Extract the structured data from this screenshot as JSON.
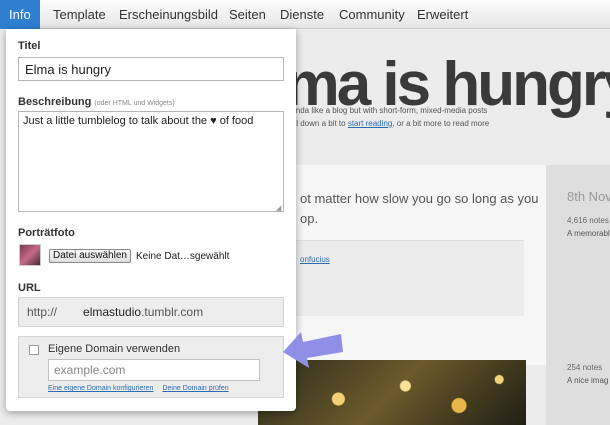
{
  "nav": {
    "tabs": [
      "Info",
      "Template",
      "Erscheinungsbild",
      "Seiten",
      "Dienste",
      "Community",
      "Erweitert"
    ],
    "active_index": 0
  },
  "colors": {
    "accent": "#2f7fd0",
    "arrow": "#8f8fe8"
  },
  "preview": {
    "title": "Elma is hungry",
    "tagline_1": "kinda like a blog but with short-form, mixed-media posts",
    "tagline_2_prefix": "oll down a bit to",
    "tagline_2_link": "start reading",
    "tagline_2_suffix": ", or a bit more to read more",
    "quote": "ot matter how slow you go so long as you op.",
    "quote_source": "onfucius",
    "side_date": "8th Nov",
    "side_notes_1": "4,616 notes",
    "side_link_1": "A memorabl",
    "side_notes_2": "254 notes",
    "side_link_2": "A nice imag"
  },
  "settings": {
    "title_label": "Titel",
    "title_value": "Elma is hungry",
    "description_label": "Beschreibung",
    "description_hint": "(oder HTML und Widgets)",
    "description_value": "Just a little tumblelog to talk about the ♥ of food",
    "portrait_label": "Porträtfoto",
    "file_button": "Datei auswählen",
    "file_name": "Keine Dat…sgewählt",
    "url_label": "URL",
    "url_prefix": "http://",
    "url_subdomain": "elmastudio",
    "url_suffix": ".tumblr.com",
    "custom_domain_label": "Eigene Domain verwenden",
    "custom_domain_checked": false,
    "domain_placeholder": "example.com",
    "link_configure": "Eine eigene Domain konfigurieren",
    "link_check": "Deine Domain prüfen"
  }
}
